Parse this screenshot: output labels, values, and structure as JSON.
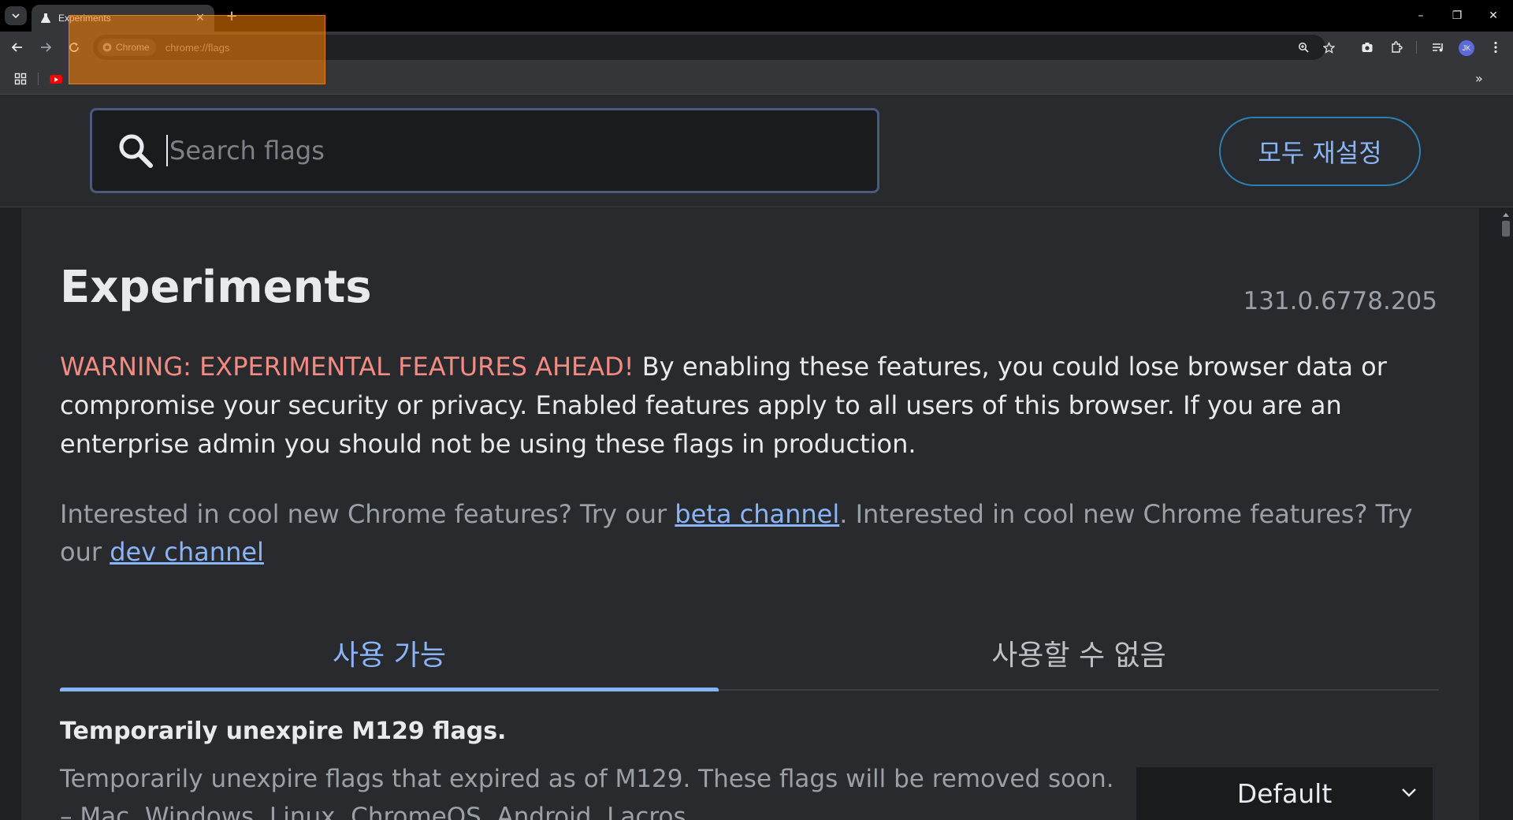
{
  "browser": {
    "tab": {
      "title": "Experiments"
    },
    "omnibox": {
      "chip_label": "Chrome",
      "url": "chrome://flags"
    },
    "profile_initials": "JK",
    "window_controls": {
      "minimize": "–",
      "restore": "❐",
      "close": "✕"
    },
    "new_tab_label": "+",
    "bookmarks_more": "»"
  },
  "flags_page": {
    "search": {
      "placeholder": "Search flags",
      "value": ""
    },
    "reset_all_label": "모두 재설정",
    "title": "Experiments",
    "version": "131.0.6778.205",
    "warning_lead": "WARNING: EXPERIMENTAL FEATURES AHEAD!",
    "warning_body": " By enabling these features, you could lose browser data or compromise your security or privacy. Enabled features apply to all users of this browser. If you are an enterprise admin you should not be using these flags in production.",
    "channel_prefix_1": "Interested in cool new Chrome features? Try our ",
    "beta_link": "beta channel",
    "channel_prefix_2": ". Interested in cool new Chrome features? Try our ",
    "dev_link": "dev channel",
    "tabs": {
      "available": "사용 가능",
      "unavailable": "사용할 수 없음"
    },
    "flags": [
      {
        "title": "Temporarily unexpire M129 flags.",
        "description": "Temporarily unexpire flags that expired as of M129. These flags will be removed soon. – Mac, Windows, Linux, ChromeOS, Android, Lacros",
        "selected_option": "Default"
      }
    ]
  },
  "colors": {
    "warning": "#f28b82",
    "link": "#8ab4f8",
    "reset_border": "#2f7fb3",
    "highlight": "#ff8200"
  }
}
